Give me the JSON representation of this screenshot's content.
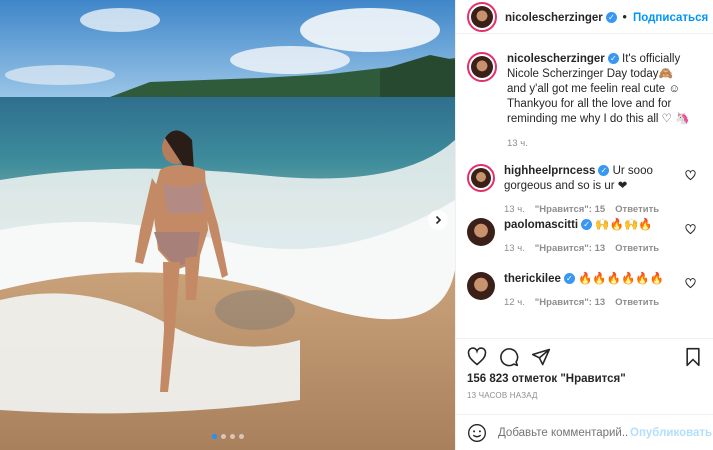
{
  "header": {
    "username": "nicolescherzinger",
    "follow_label": "Подписаться"
  },
  "caption": {
    "username": "nicolescherzinger",
    "text": "It's officially Nicole Scherzinger Day today🙈 and y'all got me feelin real cute ☺ Thankyou for all the love and for reminding me why I do this all ♡ 🦄",
    "time": "13 ч."
  },
  "comments": [
    {
      "username": "highheelprncess",
      "text": "Ur sooo gorgeous and so is ur ❤",
      "time": "13 ч.",
      "likes": "\"Нравится\": 15",
      "reply": "Ответить"
    },
    {
      "username": "paolomascitti",
      "text": "🙌🔥🙌🔥",
      "time": "13 ч.",
      "likes": "\"Нравится\": 13",
      "reply": "Ответить"
    },
    {
      "username": "therickilee",
      "text": "🔥🔥🔥🔥🔥🔥",
      "time": "12 ч.",
      "likes": "\"Нравится\": 13",
      "reply": "Ответить"
    }
  ],
  "actions": {
    "likes": "156 823 отметок \"Нравится\"",
    "time_ago": "13 ЧАСОВ НАЗАД"
  },
  "comment_box": {
    "placeholder": "Добавьте комментарий...",
    "publish_label": "Опубликовать"
  },
  "carousel": {
    "slide_count": 4,
    "active_index": 0
  },
  "colors": {
    "accent": "#0095f6",
    "verified": "#3897f0",
    "story_ring": "#e1306c"
  }
}
